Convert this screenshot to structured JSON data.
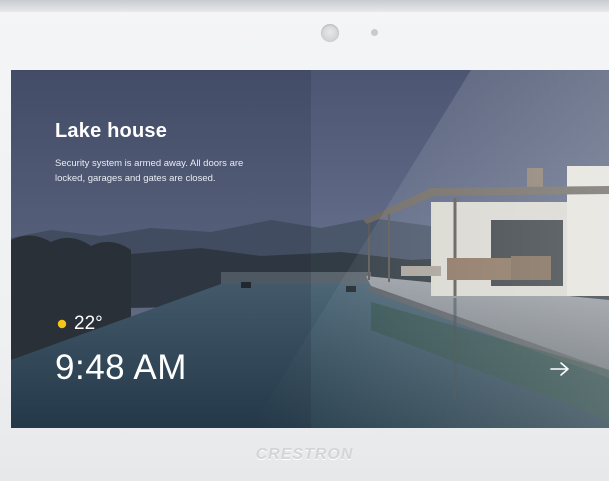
{
  "panel": {
    "brand": "CRESTRON"
  },
  "home": {
    "title": "Lake house",
    "status": "Security system is armed away. All doors are locked, garages and gates are closed.",
    "weather": {
      "icon": "sun-icon",
      "temperature": "22°"
    },
    "time": "9:48 AM",
    "next_icon": "arrow-right-icon"
  },
  "colors": {
    "sun": "#f5c518",
    "text": "#ffffff",
    "water": "#37586a",
    "sky": "#5a6682"
  }
}
